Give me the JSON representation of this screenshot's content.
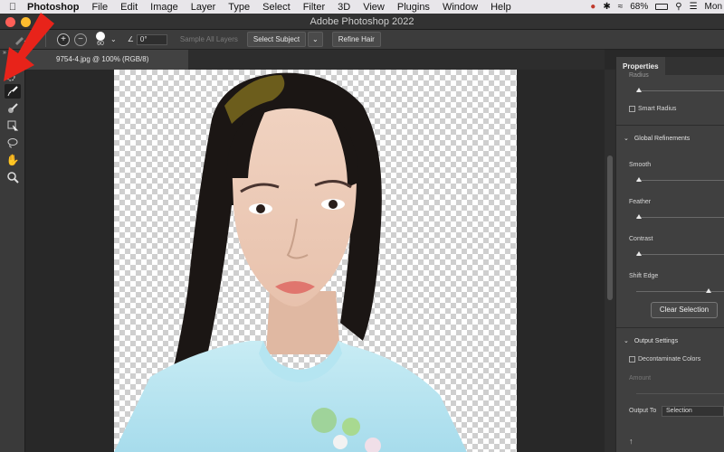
{
  "menubar": {
    "items": [
      "Photoshop",
      "File",
      "Edit",
      "Image",
      "Layer",
      "Type",
      "Select",
      "Filter",
      "3D",
      "View",
      "Plugins",
      "Window",
      "Help"
    ],
    "battery": "68%",
    "clock": "Mon"
  },
  "window": {
    "title": "Adobe Photoshop 2022"
  },
  "options": {
    "brush_size": "60",
    "angle": "0°",
    "sample_all_layers": "Sample All Layers",
    "select_subject": "Select Subject",
    "refine_hair": "Refine Hair"
  },
  "document": {
    "tab": "9754-4.jpg @ 100% (RGB/8)"
  },
  "properties": {
    "tab": "Properties",
    "radius_label": "Radius",
    "smart_radius": "Smart Radius",
    "global_refinements": "Global Refinements",
    "smooth": "Smooth",
    "feather": "Feather",
    "contrast": "Contrast",
    "shift_edge": "Shift Edge",
    "clear_selection": "Clear Selection",
    "output_settings": "Output Settings",
    "decontaminate": "Decontaminate Colors",
    "amount": "Amount",
    "output_to_label": "Output To",
    "output_to_value": "Selection"
  },
  "colors": {
    "annotation_arrow": "#e8231a",
    "accent": "#323232"
  }
}
